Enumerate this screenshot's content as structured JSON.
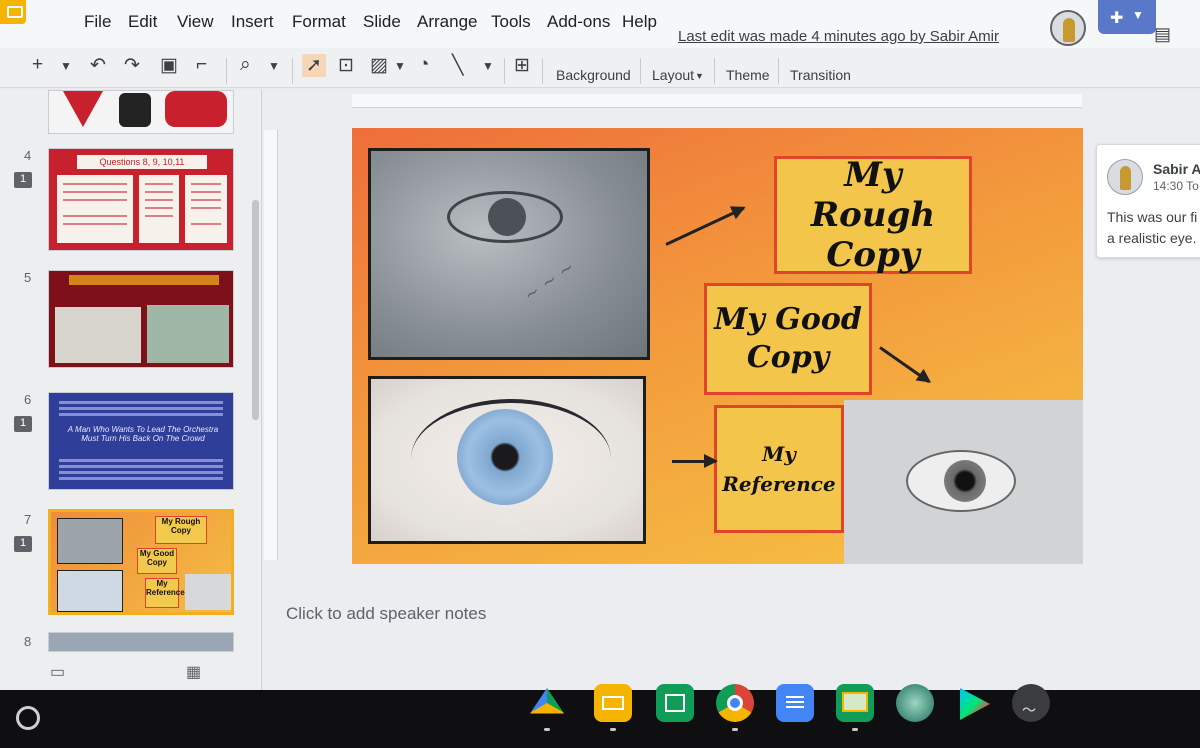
{
  "menu": {
    "items": [
      "File",
      "Edit",
      "View",
      "Insert",
      "Format",
      "Slide",
      "Arrange",
      "Tools",
      "Add-ons",
      "Help"
    ],
    "last_edit": "Last edit was made 4 minutes ago by Sabir Amir"
  },
  "toolbar": {
    "background": "Background",
    "layout": "Layout",
    "theme": "Theme",
    "transition": "Transition"
  },
  "filmstrip": {
    "slides": [
      {
        "number": "4",
        "has_comment": true,
        "title": "Questions 8, 9, 10,11"
      },
      {
        "number": "5",
        "has_comment": false
      },
      {
        "number": "6",
        "has_comment": true,
        "title": "A Man Who Wants To Lead The Orchestra Must Turn His Back On The Crowd"
      },
      {
        "number": "7",
        "has_comment": true,
        "selected": true
      },
      {
        "number": "8",
        "has_comment": false
      }
    ]
  },
  "slide": {
    "label_rough": "My Rough Copy",
    "label_good": "My Good Copy",
    "label_reference": "My Reference"
  },
  "speaker_notes": "Click to add speaker notes",
  "comment": {
    "author": "Sabir A",
    "time": "14:30 To",
    "text_line1": "This was our fi",
    "text_line2": "a realistic eye."
  },
  "colors": {
    "accent_selected": "#f2b01e",
    "label_fill": "#f3c64b",
    "label_border": "#e0452c",
    "slide_gradient_start": "#ee6e3a",
    "slide_gradient_end": "#f6c544"
  },
  "shelf": {
    "apps": [
      "google-drive-icon",
      "google-slides-icon",
      "google-sheets-icon",
      "chrome-icon",
      "google-docs-icon",
      "google-classroom-icon",
      "globe-app-icon",
      "play-store-icon",
      "activity-app-icon"
    ]
  }
}
